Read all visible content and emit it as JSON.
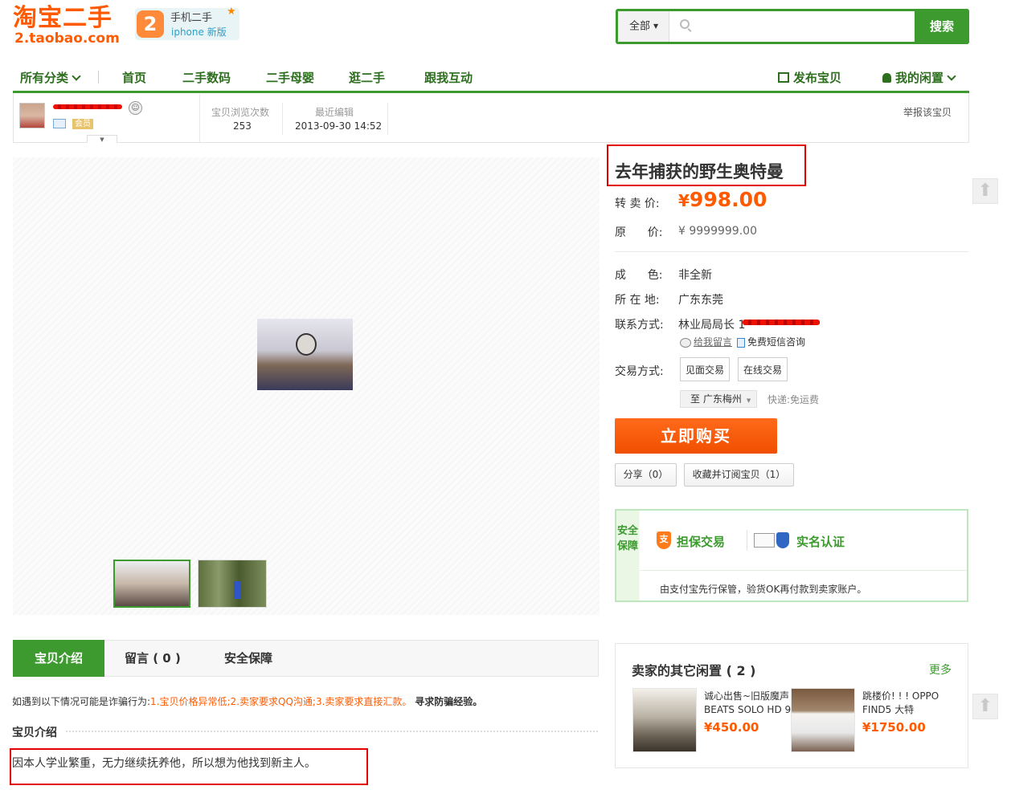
{
  "header": {
    "logo_main": "淘宝二手",
    "logo_sub": "2.taobao.com",
    "mobile_icon": "2",
    "mobile_top": "手机二手",
    "mobile_bottom": "iphone 新版",
    "search": {
      "category": "全部",
      "placeholder": "",
      "button": "搜索"
    }
  },
  "nav": {
    "all_categories": "所有分类",
    "items": [
      "首页",
      "二手数码",
      "二手母婴",
      "逛二手",
      "跟我互动"
    ],
    "post": "发布宝贝",
    "mine": "我的闲置"
  },
  "seller_bar": {
    "member_badge": "会员",
    "views_label": "宝贝浏览次数",
    "views_value": "253",
    "edited_label": "最近编辑",
    "edited_value": "2013-09-30 14:52",
    "report": "举报该宝贝"
  },
  "item": {
    "title": "去年捕获的野生奥特曼",
    "price_label": "转 卖 价:",
    "price_currency": "¥",
    "price": "998.00",
    "orig_label": "原      价:",
    "orig_price": "¥ 9999999.00",
    "condition_label": "成      色:",
    "condition": "非全新",
    "location_label": "所 在 地:",
    "location": "广东东莞",
    "contact_label": "联系方式:",
    "contact": "林业局局长 1",
    "leave_msg": "给我留言",
    "sms": "免费短信咨询",
    "trade_label": "交易方式:",
    "trade_options": [
      "见面交易",
      "在线交易"
    ],
    "ship_to": "至 广东梅州",
    "ship_fee": "快递:免运费",
    "buy": "立即购买",
    "share": "分享（0）",
    "favorite": "收藏并订阅宝贝（1）"
  },
  "safety": {
    "side": "安全保障",
    "guarantee": "担保交易",
    "realname": "实名认证",
    "desc": "由支付宝先行保管，验货OK再付款到卖家账户。"
  },
  "tabs": {
    "intro": "宝贝介绍",
    "comments": "留言 ( 0 )",
    "safety": "安全保障"
  },
  "warning": {
    "prefix": "如遇到以下情况可能是诈骗行为:",
    "items": [
      "1.宝贝价格异常低;",
      "2.卖家要求QQ沟通;",
      "3.卖家要求直接汇款。"
    ],
    "link": "寻求防骗经验。"
  },
  "description": {
    "title": "宝贝介绍",
    "text": "因本人学业繁重，无力继续抚养他，所以想为他找到新主人。"
  },
  "others": {
    "title": "卖家的其它闲置 ( 2 )",
    "more": "更多",
    "items": [
      {
        "name": "诚心出售~旧版魔声BEATS SOLO HD 9",
        "price": "¥450.00"
      },
      {
        "name": "跳楼价! ! ! OPPO FIND5 大特",
        "price": "¥1750.00"
      }
    ]
  },
  "colors": {
    "brand_green": "#3c9a2f",
    "accent_orange": "#ff5a00",
    "highlight_red": "#e30000"
  }
}
